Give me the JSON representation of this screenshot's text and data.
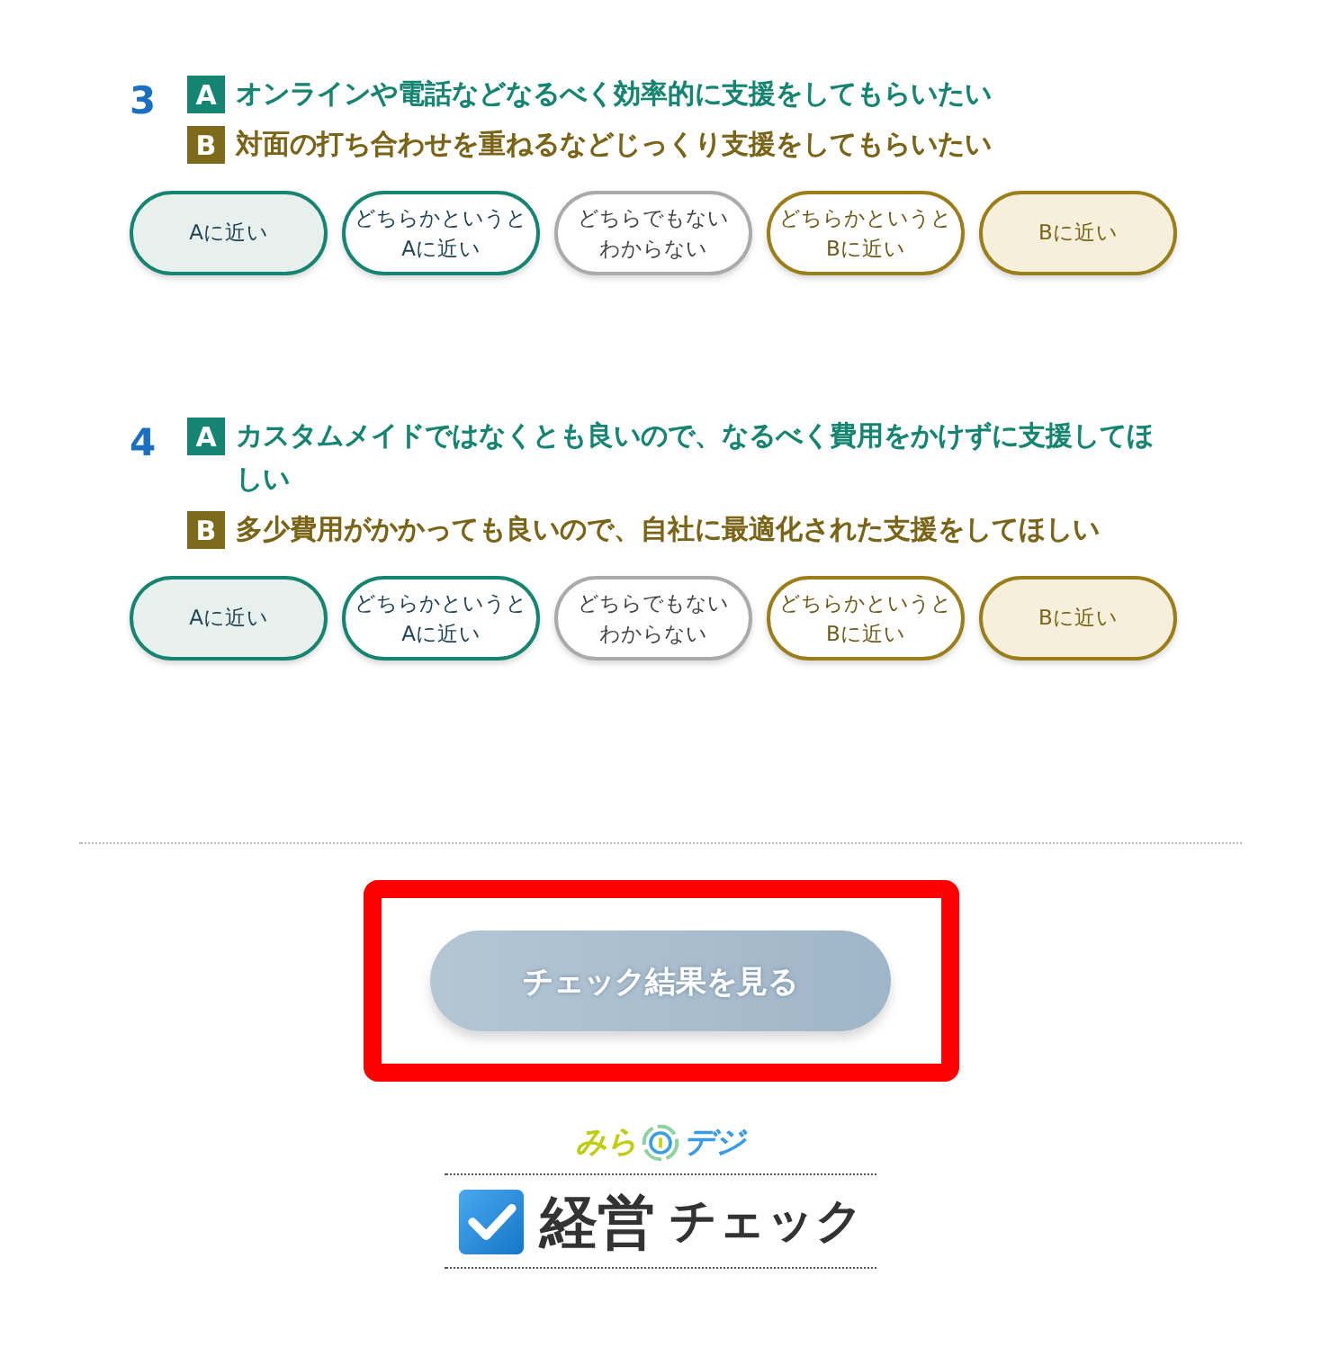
{
  "questions": [
    {
      "number": "3",
      "choices": [
        {
          "kind": "a",
          "badge": "A",
          "text": "オンラインや電話などなるべく効率的に支援をしてもらいたい"
        },
        {
          "kind": "b",
          "badge": "B",
          "text": "対面の打ち合わせを重ねるなどじっくり支援をしてもらいたい"
        }
      ],
      "options": [
        {
          "kind": "a",
          "lines": [
            "Aに近い"
          ],
          "selected": false
        },
        {
          "kind": "a-lean",
          "lines": [
            "どちらかというと",
            "Aに近い"
          ],
          "selected": false
        },
        {
          "kind": "neutral",
          "lines": [
            "どちらでもない",
            "わからない"
          ],
          "selected": false
        },
        {
          "kind": "b-lean",
          "lines": [
            "どちらかというと",
            "Bに近い"
          ],
          "selected": false
        },
        {
          "kind": "b",
          "lines": [
            "Bに近い"
          ],
          "selected": false
        }
      ]
    },
    {
      "number": "4",
      "choices": [
        {
          "kind": "a",
          "badge": "A",
          "text": "カスタムメイドではなくとも良いので、なるべく費用をかけずに支援してほしい"
        },
        {
          "kind": "b",
          "badge": "B",
          "text": "多少費用がかかっても良いので、自社に最適化された支援をしてほしい"
        }
      ],
      "options": [
        {
          "kind": "a",
          "lines": [
            "Aに近い"
          ],
          "selected": false
        },
        {
          "kind": "a-lean",
          "lines": [
            "どちらかというと",
            "Aに近い"
          ],
          "selected": false
        },
        {
          "kind": "neutral",
          "lines": [
            "どちらでもない",
            "わからない"
          ],
          "selected": false
        },
        {
          "kind": "b-lean",
          "lines": [
            "どちらかというと",
            "Bに近い"
          ],
          "selected": false
        },
        {
          "kind": "b",
          "lines": [
            "Bに近い"
          ],
          "selected": false
        }
      ]
    }
  ],
  "submit": {
    "label": "チェック結果を見る",
    "disabled": true,
    "highlighted": true
  },
  "logo": {
    "brand_left": "みら",
    "brand_right": "デジ",
    "title_kanji": "経営",
    "title_kana": "チェック"
  }
}
